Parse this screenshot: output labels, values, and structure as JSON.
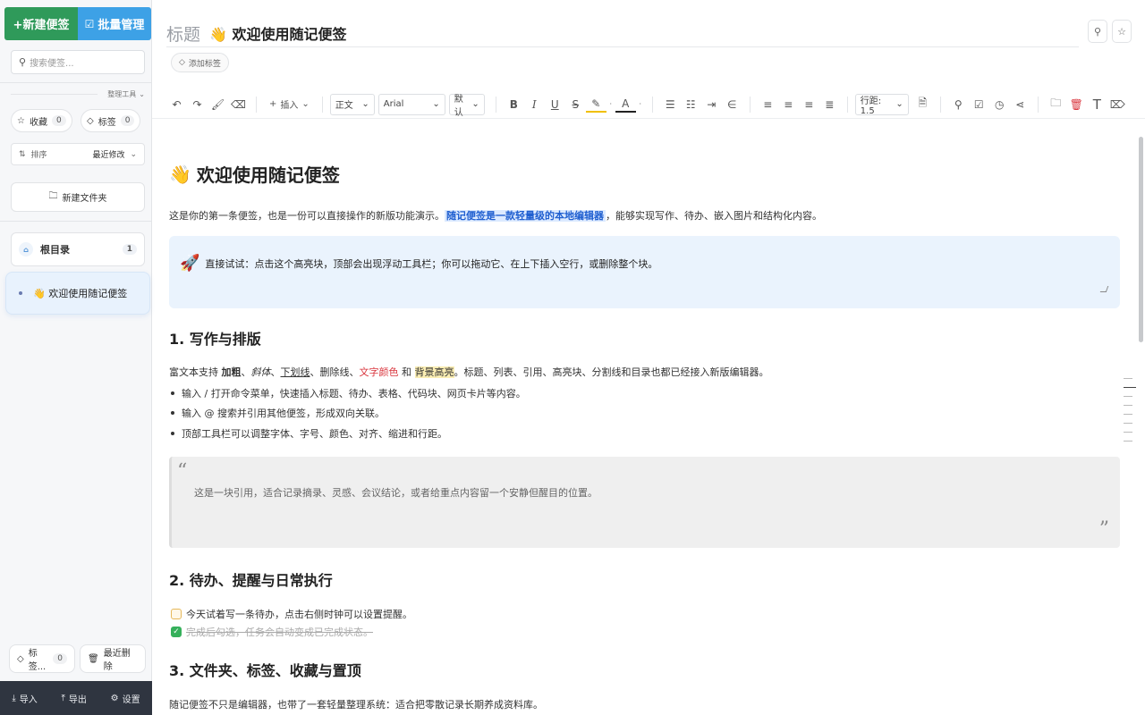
{
  "sidebar": {
    "new_note": "+新建便签",
    "batch": "批量管理",
    "search_placeholder": "搜索便签...",
    "tools_label": "整理工具",
    "favorites": {
      "label": "收藏",
      "count": "0"
    },
    "tags": {
      "label": "标签",
      "count": "0"
    },
    "sort": {
      "label": "排序",
      "value": "最近修改"
    },
    "new_folder": "新建文件夹",
    "root_folder": {
      "label": "根目录",
      "count": "1"
    },
    "notes": [
      {
        "label": "欢迎使用随记便签",
        "emoji": "👋"
      }
    ],
    "bottom_tags": {
      "label": "标签...",
      "count": "0"
    },
    "recently_deleted": "最近删除",
    "footer": {
      "import": "导入",
      "export": "导出",
      "settings": "设置"
    }
  },
  "editor": {
    "title_label": "标题",
    "title": "👋 欢迎使用随记便签",
    "add_tag": "添加标签",
    "toolbar": {
      "insert": "插入",
      "paragraph": "正文",
      "font": "Arial",
      "size": "默认",
      "line_height": "行距: 1.5"
    }
  },
  "doc": {
    "h1": "欢迎使用随记便签",
    "h1_emoji": "👋",
    "intro_a": "这是你的第一条便签，也是一份可以直接操作的新版功能演示。",
    "intro_hl": "随记便签是一款轻量级的本地编辑器",
    "intro_b": "，能够实现写作、待办、嵌入图片和结构化内容。",
    "callout": "直接试试：点击这个高亮块，顶部会出现浮动工具栏；你可以拖动它、在上下插入空行，或删除整个块。",
    "callout_emoji": "🚀",
    "s1": "1. 写作与排版",
    "s1_p1": "富文本支持",
    "s1_bold": "加粗",
    "s1_sep1": "、",
    "s1_italic": "斜体",
    "s1_sep2": "、",
    "s1_underline": "下划线",
    "s1_sep3": "、删除线、",
    "s1_color": "文字颜色",
    "s1_and": " 和 ",
    "s1_bg": "背景高亮",
    "s1_rest": "。标题、列表、引用、高亮块、分割线和目录也都已经接入新版编辑器。",
    "bullets": [
      "输入 / 打开命令菜单，快速插入标题、待办、表格、代码块、网页卡片等内容。",
      "输入 @ 搜索并引用其他便签，形成双向关联。",
      "顶部工具栏可以调整字体、字号、颜色、对齐、缩进和行距。"
    ],
    "quote": "这是一块引用，适合记录摘录、灵感、会议结论，或者给重点内容留一个安静但醒目的位置。",
    "s2": "2. 待办、提醒与日常执行",
    "todo1": "今天试着写一条待办，点击右侧时钟可以设置提醒。",
    "todo2": "完成后勾选，任务会自动变成已完成状态。",
    "s3": "3. 文件夹、标签、收藏与置顶",
    "s3_p": "随记便签不只是编辑器，也带了一套轻量整理系统：适合把零散记录长期养成资料库。"
  },
  "colors": {
    "green": "#2f9a5a",
    "blue": "#3da1e6",
    "highlight": "#1f5fd0",
    "red": "#d9363e"
  }
}
